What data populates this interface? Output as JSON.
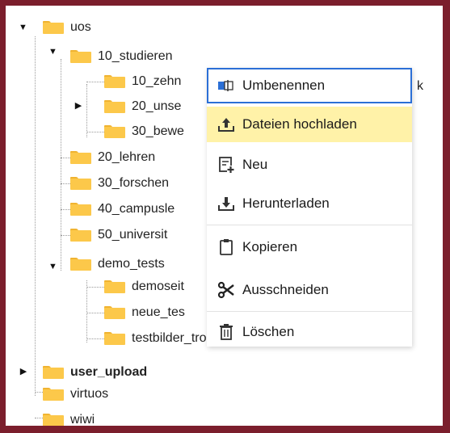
{
  "tree": {
    "nodes": [
      {
        "id": "uos",
        "label": "uos"
      },
      {
        "id": "10_studieren",
        "label": "10_studieren"
      },
      {
        "id": "10_zehn",
        "label": "10_zehn"
      },
      {
        "id": "20_unse",
        "label": "20_unse"
      },
      {
        "id": "30_bewe",
        "label": "30_bewe"
      },
      {
        "id": "20_lehren",
        "label": "20_lehren"
      },
      {
        "id": "30_forschen",
        "label": "30_forschen"
      },
      {
        "id": "40_campusle",
        "label": "40_campusle"
      },
      {
        "id": "50_universit",
        "label": "50_universit"
      },
      {
        "id": "demo_tests",
        "label": "demo_tests"
      },
      {
        "id": "demoseit",
        "label": "demoseit"
      },
      {
        "id": "neue_tes",
        "label": "neue_tes"
      },
      {
        "id": "testbilder",
        "label": "testbilder_tron"
      },
      {
        "id": "user_upload",
        "label": "user_upload"
      },
      {
        "id": "virtuos",
        "label": "virtuos"
      },
      {
        "id": "wiwi",
        "label": "wiwi"
      }
    ],
    "hidden_suffix": "k"
  },
  "context_menu": {
    "items": [
      {
        "id": "rename",
        "label": "Umbenennen",
        "icon": "rename-icon"
      },
      {
        "id": "upload",
        "label": "Dateien hochladen",
        "icon": "upload-icon"
      },
      {
        "id": "new",
        "label": "Neu",
        "icon": "new-file-icon"
      },
      {
        "id": "download",
        "label": "Herunterladen",
        "icon": "download-icon"
      },
      {
        "id": "copy",
        "label": "Kopieren",
        "icon": "clipboard-icon"
      },
      {
        "id": "cut",
        "label": "Ausschneiden",
        "icon": "scissors-icon"
      },
      {
        "id": "delete",
        "label": "Löschen",
        "icon": "trash-icon"
      }
    ],
    "focused_item": "rename",
    "hovered_item": "upload"
  },
  "colors": {
    "frame": "#7b1e2c",
    "folder": "#fcc84a",
    "focus_outline": "#2b6fd6",
    "hover_highlight": "#fff2a8"
  }
}
